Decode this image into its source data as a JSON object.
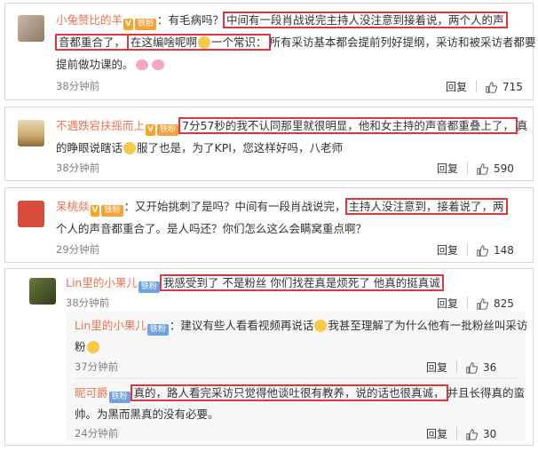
{
  "comments": [
    {
      "name": "小兔赞比的羊",
      "badge_fan": "铁粉",
      "line1_pre": "：有毛病吗？",
      "line1_hl": "中间有一段肖战说完主持人没注意到接着说，两个人的声",
      "line2_hl": "音都重合了，",
      "line2_hl2_pre": "在这编啥呢啊",
      "line2_hl2_post": "一个常识：",
      "line2_post": "所有采访基本都会提前列好提纲，采访和被采访者都要",
      "line3": "提前做功课的。",
      "time": "38分钟前",
      "reply": "回复",
      "likes": "715"
    },
    {
      "name": "不遇跌宕扶摇而上",
      "badge_fan": "铁粉",
      "line1_hl": "7分57秒的我不认同那里就很明显，他和女主持的声音都重叠上了，",
      "line1_post": "真",
      "line2_pre": "的睁眼说瞎话",
      "line2_post": "服了也是，为了KPI，您这样好吗，八老师",
      "time": "38分钟前",
      "reply": "回复",
      "likes": "590"
    },
    {
      "name": "呆桃燚",
      "badge_fan": "铁粉",
      "line1_pre": "：又开始挑刺了是吗？中间有一段肖战说完，",
      "line1_hl": "主持人没注意到，接着说了，两",
      "line2": "个人的声音都重合了。是人吗还？你们怎么这么会瞒窝重点啊？",
      "time": "29分钟前",
      "reply": "回复",
      "likes": "148"
    },
    {
      "name": "Lin里的小果儿",
      "badge_fan": "铁粉",
      "line1_hl": "我感受到了 不是粉丝 你们找茬真是烦死了 他真的挺真诚",
      "time": "38分钟前",
      "reply": "回复",
      "likes": "825"
    }
  ],
  "replies": [
    {
      "name": "Lin里的小果儿",
      "badge_fan": "铁粉",
      "line1_pre": "：建议有些人看看视频再说话",
      "line1_post": "我甚至理解了为什么他有一批粉丝叫采访",
      "line2": "粉",
      "time": "37分钟前",
      "reply": "回复",
      "likes": "36"
    },
    {
      "name": "昵可爵",
      "badge_fan": "铁粉",
      "line1_hl": "真的，路人看完采访只觉得他谈吐很有教养，说的话也很真诚，",
      "line1_post": "并且长得真的蛮",
      "line2": "帅。为黑而黑真的没有必要。",
      "time": "24分钟前",
      "reply": "回复",
      "likes": "30"
    }
  ],
  "colors": {
    "highlight": "#e0353a",
    "name": "#eb7350",
    "text": "#333333",
    "muted": "#808080"
  }
}
